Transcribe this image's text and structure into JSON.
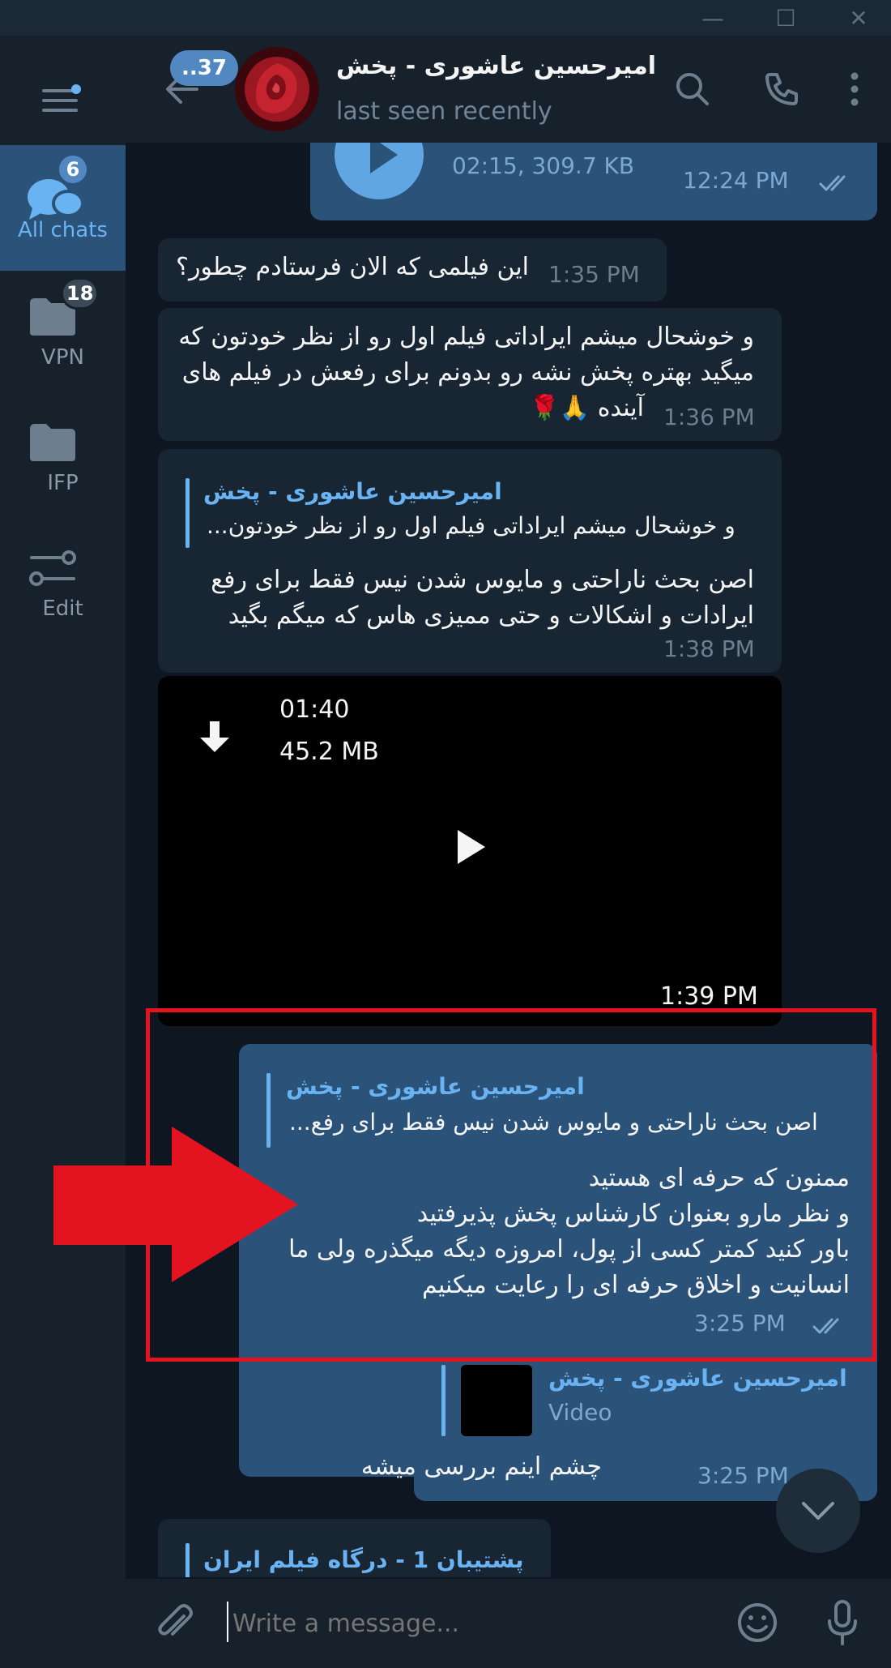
{
  "window": {
    "minimize_glyph": "—",
    "maximize_glyph": "☐",
    "close_glyph": "✕"
  },
  "sidebar": {
    "items": [
      {
        "label": "All chats",
        "badge": "6",
        "icon": "chats-icon"
      },
      {
        "label": "VPN",
        "badge": "18",
        "icon": "folder-icon"
      },
      {
        "label": "IFP",
        "badge": "",
        "icon": "folder-icon"
      },
      {
        "label": "Edit",
        "badge": "",
        "icon": "sliders-icon"
      }
    ]
  },
  "header": {
    "unread_badge": "..37",
    "title": "امیرحسین عاشوری - پخش",
    "status": "last seen recently"
  },
  "messages": {
    "audio": {
      "meta": "02:15, 309.7 KB",
      "time": "12:24 PM"
    },
    "m1": {
      "text": "این فیلمی که الان فرستادم چطور؟",
      "time": "1:35 PM"
    },
    "m2": {
      "line1": "و خوشحال میشم ایراداتی فیلم اول رو از نظر خودتون که",
      "line2": "میگید بهتره پخش نشه رو بدونم برای رفعش در فیلم های",
      "line3": "آینده 🙏🌹",
      "time": "1:36 PM"
    },
    "m3": {
      "reply_name": "امیرحسین عاشوری - پخش",
      "reply_text": "و خوشحال میشم ایراداتی فیلم اول رو از نظر خودتون...",
      "line1": "اصن بحث ناراحتی و مایوس شدن نیس فقط برای رفع",
      "line2": "ایرادات و اشکالات و حتی ممیزی هاس که میگم بگید",
      "time": "1:38 PM"
    },
    "video": {
      "duration": "01:40",
      "size": "45.2 MB",
      "time": "1:39 PM"
    },
    "m4": {
      "reply_name": "امیرحسین عاشوری - پخش",
      "reply_text": "اصن بحث ناراحتی و مایوس شدن نیس فقط برای رفع...",
      "line1": "ممنون که حرفه ای هستید",
      "line2": "و نظر مارو بعنوان کارشناس پخش پذیرفتید",
      "line3": "باور کنید کمتر کسی از پول، امروزه دیگه میگذره ولی ما",
      "line4": "انسانیت و اخلاق حرفه ای را رعایت میکنیم",
      "time": "3:25 PM"
    },
    "m5": {
      "reply_name": "امیرحسین عاشوری - پخش",
      "reply_text": "Video",
      "text": "چشم اینم بررسی میشه",
      "time": "3:25 PM"
    },
    "m6": {
      "reply_name": "پشتیبان 1 - درگاه فیلم ایران"
    }
  },
  "composer": {
    "placeholder": "Write a message..."
  },
  "colors": {
    "accent": "#6ab3f3",
    "outgoing": "#2b5278",
    "incoming": "#182533",
    "highlight": "#e3141f"
  }
}
